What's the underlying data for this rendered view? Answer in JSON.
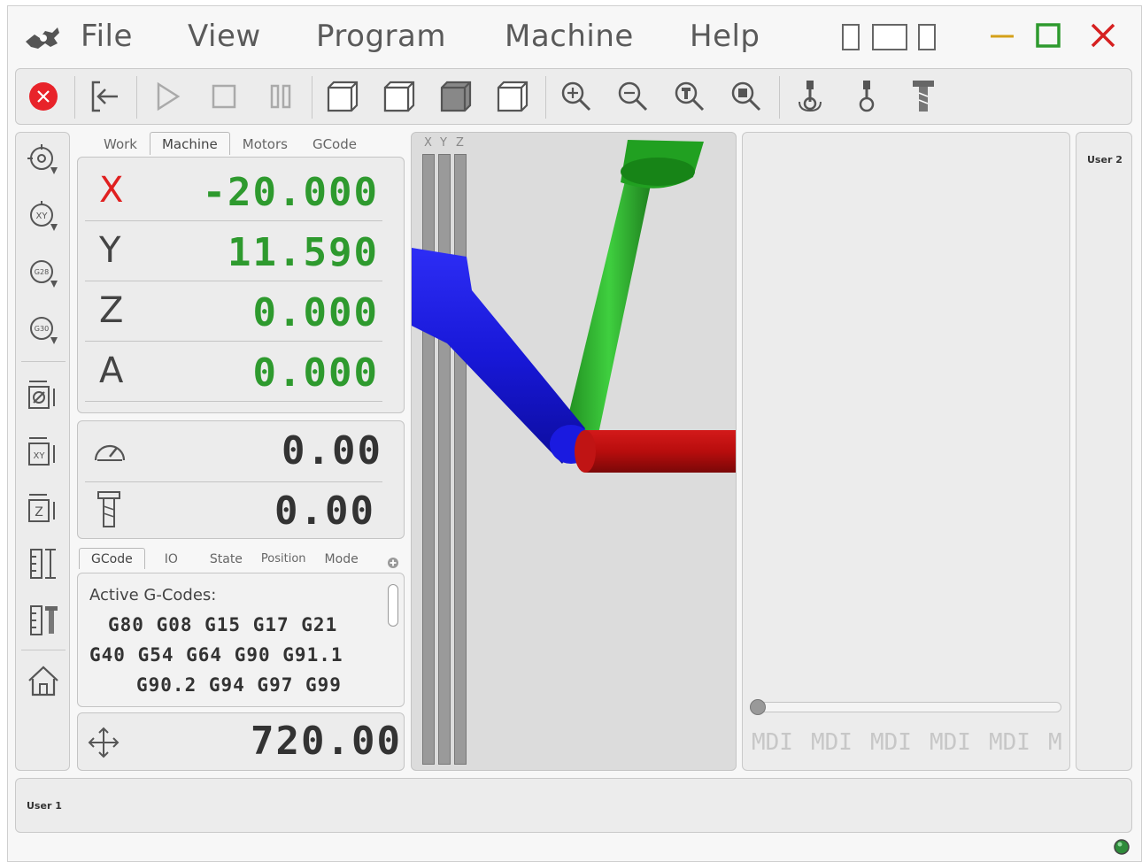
{
  "menu": {
    "items": [
      "File",
      "View",
      "Program",
      "Machine",
      "Help"
    ]
  },
  "dro_tabs": [
    "Work",
    "Machine",
    "Motors",
    "GCode"
  ],
  "dro_active_tab": "Machine",
  "axes": [
    {
      "letter": "X",
      "value": "-20.000"
    },
    {
      "letter": "Y",
      "value": "11.590"
    },
    {
      "letter": "Z",
      "value": "0.000"
    },
    {
      "letter": "A",
      "value": "0.000"
    }
  ],
  "feed": {
    "value": "0.00"
  },
  "spindle": {
    "value": "0.00"
  },
  "info_tabs": [
    "GCode",
    "IO",
    "State",
    "Position",
    "Mode"
  ],
  "info_active_tab": "GCode",
  "gcodes": {
    "heading": "Active G-Codes:",
    "lines": [
      "G80 G08 G15 G17 G21",
      "G40 G54 G64 G90 G91.1",
      "G90.2 G94 G97 G99"
    ]
  },
  "jog": {
    "value": "720.00"
  },
  "viewport": {
    "scrollbar_labels": [
      "X",
      "Y",
      "Z"
    ]
  },
  "mdi": {
    "labels": [
      "MDI",
      "MDI",
      "MDI",
      "MDI",
      "MDI",
      "M"
    ],
    "slider_level": 0.0
  },
  "user2_label": "User 2",
  "user1_label": "User 1",
  "colors": {
    "dro_green": "#2e9a2e",
    "x_axis_red": "#e02020",
    "stop_red": "#e8232a",
    "status_led": "#2e8b3a"
  }
}
